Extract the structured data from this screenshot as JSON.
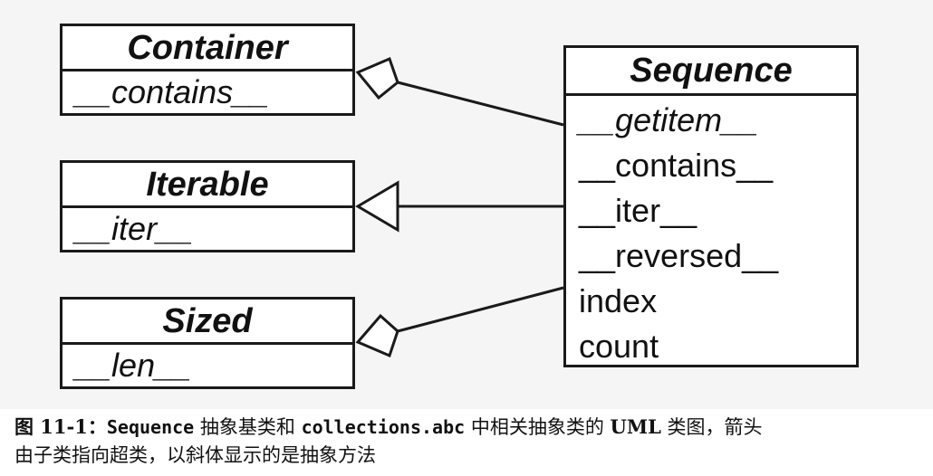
{
  "diagram": {
    "abstract_classes": [
      {
        "name": "Container",
        "members": [
          "__contains__"
        ]
      },
      {
        "name": "Iterable",
        "members": [
          "__iter__"
        ]
      },
      {
        "name": "Sized",
        "members": [
          "__len__"
        ]
      }
    ],
    "sequence": {
      "name": "Sequence",
      "members": [
        {
          "text": "__getitem__",
          "abstract": true
        },
        {
          "text": "__contains__",
          "abstract": false
        },
        {
          "text": "__iter__",
          "abstract": false
        },
        {
          "text": "__reversed__",
          "abstract": false
        },
        {
          "text": "index",
          "abstract": false
        },
        {
          "text": "count",
          "abstract": false
        }
      ]
    },
    "colors": {
      "line": "#1a1a1a",
      "background": "#f5f5f5",
      "box_fill": "#ffffff"
    }
  },
  "caption": {
    "figure_label": "图 11-1：",
    "seg_a": "Sequence",
    "seg_b": " 抽象基类和 ",
    "seg_c": "collections.abc",
    "seg_d": " 中相关抽象类的 ",
    "seg_e": "UML",
    "seg_f": " 类图，箭头",
    "line2": "由子类指向超类，以斜体显示的是抽象方法"
  }
}
